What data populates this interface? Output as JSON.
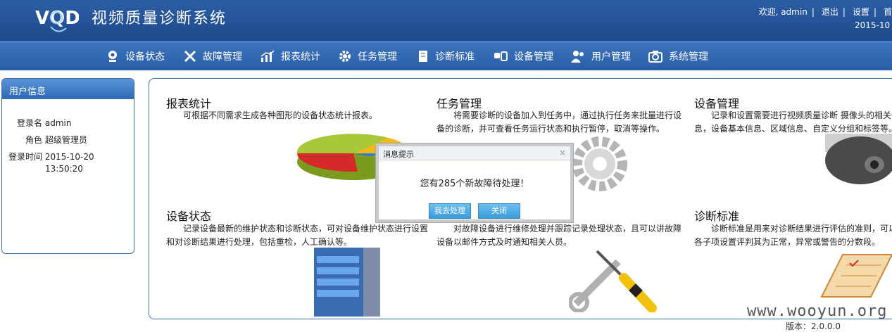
{
  "header": {
    "logo_text": "VQD",
    "title": "视频质量诊断系统",
    "welcome": "欢迎, admin",
    "logout": "退出",
    "settings": "设置",
    "home": "首",
    "date": "2015-10"
  },
  "nav": [
    {
      "label": "设备状态",
      "icon": "webcam-icon"
    },
    {
      "label": "故障管理",
      "icon": "tools-icon"
    },
    {
      "label": "报表统计",
      "icon": "chart-icon"
    },
    {
      "label": "任务管理",
      "icon": "gear-icon"
    },
    {
      "label": "诊断标准",
      "icon": "book-icon"
    },
    {
      "label": "设备管理",
      "icon": "device-icon"
    },
    {
      "label": "用户管理",
      "icon": "users-icon"
    },
    {
      "label": "系统管理",
      "icon": "camera-icon"
    }
  ],
  "sidebar": {
    "title": "用户信息",
    "login_name_label": "登录名",
    "login_name": "admin",
    "role_label": "角色",
    "role": "超级管理员",
    "login_time_label": "登录时间",
    "login_date": "2015-10-20",
    "login_clock": "13:50:20"
  },
  "modules": {
    "report": {
      "title": "报表统计",
      "desc": "可根据不同需求生成各种图形的设备状态统计报表。"
    },
    "task": {
      "title": "任务管理",
      "desc": "将需要诊断的设备加入到任务中，通过执行任务来批量进行设备的诊断，并可查看任务运行状态和执行暂停，取消等操作。"
    },
    "device": {
      "title": "设备管理",
      "desc": "记录和设置需要进行视频质量诊断 摄像头的相关信息，设备基本信息、区域信息、自定义分组和标签等。"
    },
    "status": {
      "title": "设备状态",
      "desc": "记录设备最新的维护状态和诊断状态，可对设备维护状态进行设置和对诊断结果进行处理，包括重检，人工确认等。"
    },
    "fault": {
      "desc": "对故障设备进行维修处理并跟踪记录处理状态，且可以讲故障设备以邮件方式及时通知相关人员。"
    },
    "standard": {
      "title": "诊断标准",
      "desc": "诊断标准是用来对诊断结果进行评估的准则，可以对各子项设置评判其为正常，异常或警告的分数段。"
    }
  },
  "dialog": {
    "title": "消息提示",
    "message": "您有285个新故障待处理！",
    "go_button": "我去处理",
    "close_button": "关闭"
  },
  "watermark": "www.wooyun.org",
  "version": "版本：2.0.0.0"
}
